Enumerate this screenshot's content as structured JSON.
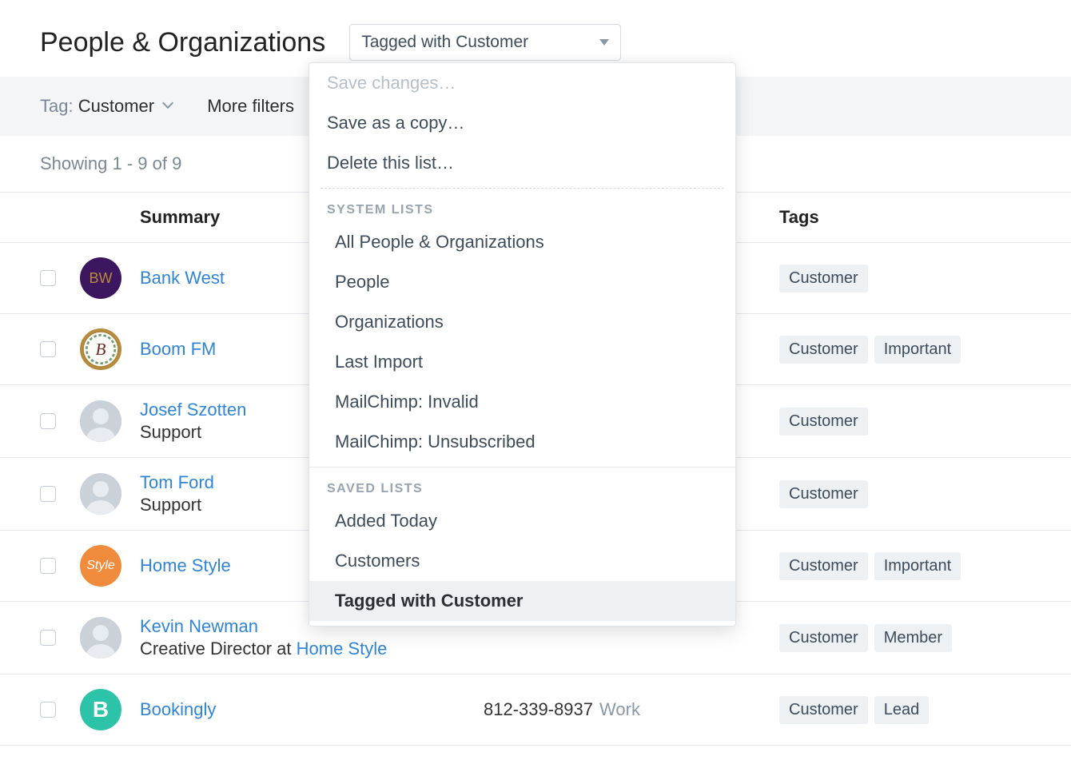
{
  "header": {
    "title": "People & Organizations",
    "dropdown_label": "Tagged with Customer"
  },
  "filters": {
    "tag_label": "Tag:",
    "tag_value": "Customer",
    "more_filters": "More filters"
  },
  "showing": "Showing 1 - 9 of 9",
  "columns": {
    "summary": "Summary",
    "tags": "Tags"
  },
  "dropdown": {
    "save_changes": "Save changes…",
    "save_copy": "Save as a copy…",
    "delete_list": "Delete this list…",
    "system_heading": "SYSTEM LISTS",
    "system_items": [
      "All People & Organizations",
      "People",
      "Organizations",
      "Last Import",
      "MailChimp: Invalid",
      "MailChimp: Unsubscribed"
    ],
    "saved_heading": "SAVED LISTS",
    "saved_items": [
      "Added Today",
      "Customers",
      "Tagged with Customer"
    ]
  },
  "rows": [
    {
      "avatar_text": "BW",
      "avatar_class": "avatar-bank",
      "name": "Bank West",
      "subline_prefix": "",
      "subline_link": "",
      "phone": "",
      "phone_type": "",
      "tags": [
        "Customer"
      ]
    },
    {
      "avatar_text": "",
      "avatar_class": "avatar-boom",
      "name": "Boom FM",
      "subline_prefix": "",
      "subline_link": "",
      "phone": "",
      "phone_type": "",
      "tags": [
        "Customer",
        "Important"
      ]
    },
    {
      "avatar_text": "",
      "avatar_class": "avatar-person",
      "name": "Josef Szotten",
      "subline_prefix": "Support",
      "subline_link": "",
      "phone": "",
      "phone_type": "",
      "tags": [
        "Customer"
      ]
    },
    {
      "avatar_text": "",
      "avatar_class": "avatar-person",
      "name": "Tom Ford",
      "subline_prefix": "Support",
      "subline_link": "",
      "phone": "",
      "phone_type": "",
      "tags": [
        "Customer"
      ]
    },
    {
      "avatar_text": "Style",
      "avatar_class": "avatar-style",
      "name": "Home Style",
      "subline_prefix": "",
      "subline_link": "",
      "phone": "",
      "phone_type": "",
      "tags": [
        "Customer",
        "Important"
      ]
    },
    {
      "avatar_text": "",
      "avatar_class": "avatar-person",
      "name": "Kevin Newman",
      "subline_prefix": "Creative Director at ",
      "subline_link": "Home Style",
      "phone": "",
      "phone_type": "",
      "tags": [
        "Customer",
        "Member"
      ]
    },
    {
      "avatar_text": "B",
      "avatar_class": "avatar-book",
      "name": "Bookingly",
      "subline_prefix": "",
      "subline_link": "",
      "phone": "812-339-8937",
      "phone_type": "Work",
      "tags": [
        "Customer",
        "Lead"
      ]
    }
  ]
}
